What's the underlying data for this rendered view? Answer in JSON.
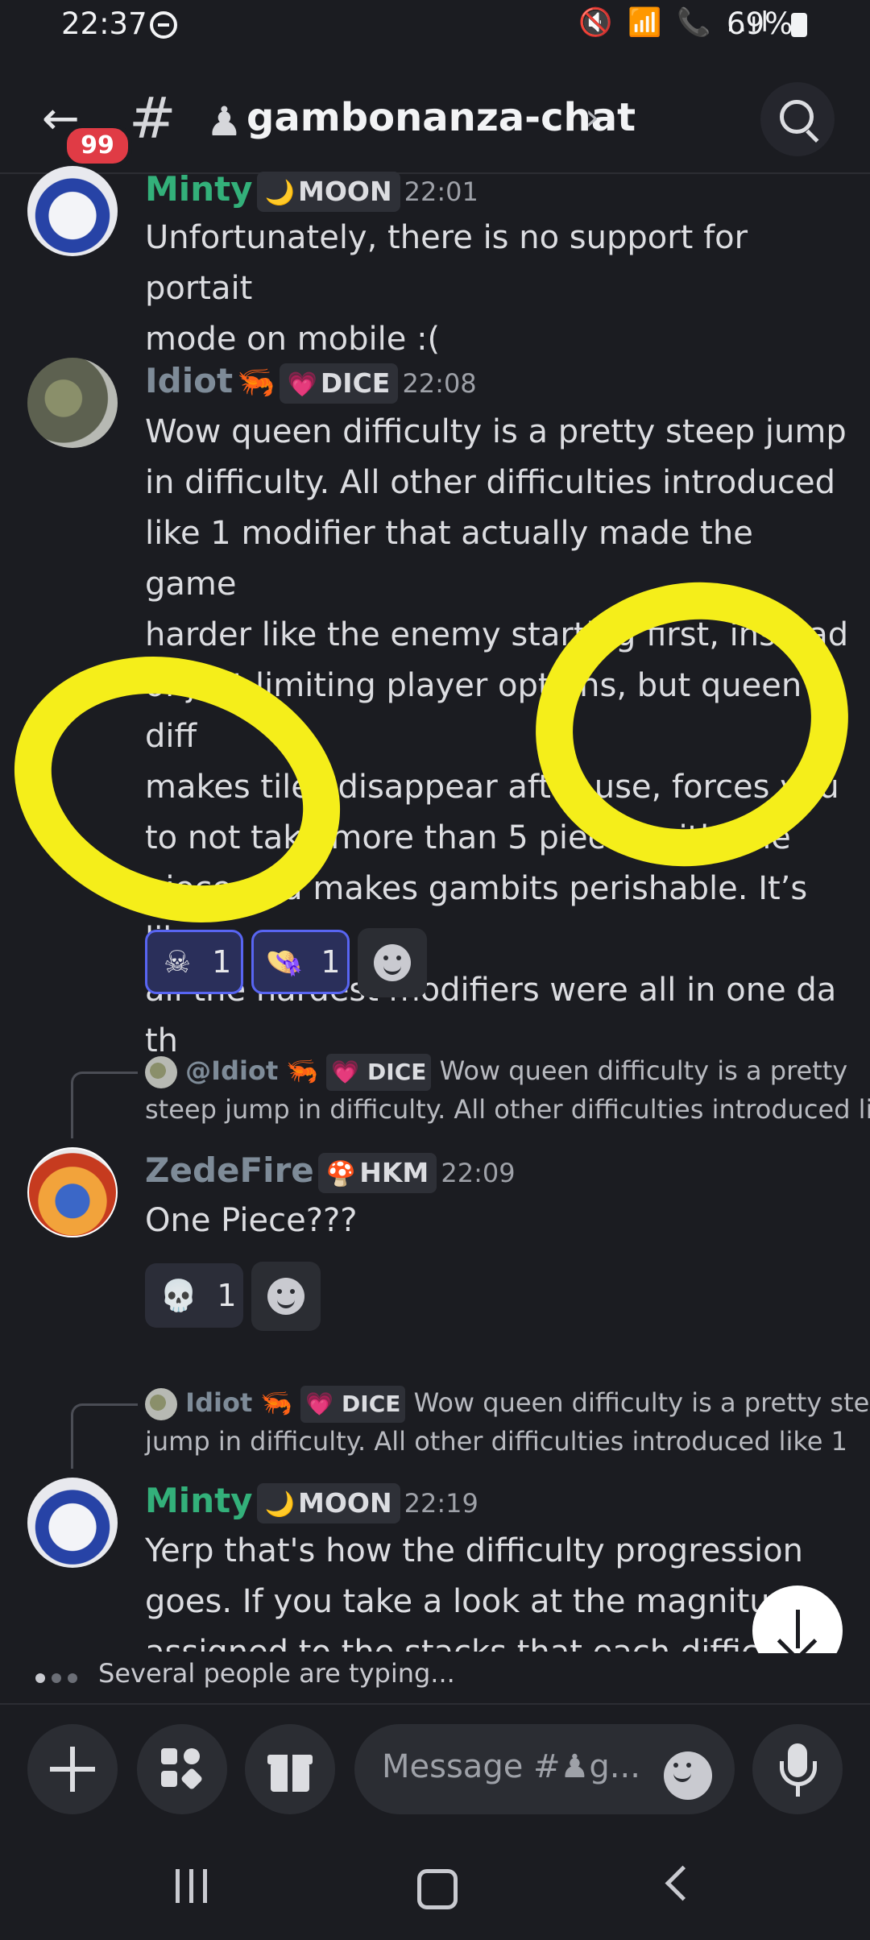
{
  "status_bar": {
    "time": "22:37",
    "signal_icons": "🔇 📶 📞 ..ıl",
    "battery": "69%"
  },
  "header": {
    "unread_count": "99",
    "hash": "#",
    "channel_emoji": "♟",
    "channel_name": "gambonanza-chat",
    "chevron": "›"
  },
  "messages": [
    {
      "user": "Minty",
      "role_icon": "🌙",
      "role": "MOON",
      "time": "22:01",
      "lines": [
        "Unfortunately, there is no support for portait",
        "mode on mobile :("
      ]
    },
    {
      "user": "Idiot",
      "user_emoji": "🦐",
      "role_icon": "💗",
      "role": "DICE",
      "time": "22:08",
      "lines": [
        "Wow queen difficulty is a pretty steep jump",
        "in difficulty. All other difficulties introduced",
        "like 1 modifier that actually made the game",
        "harder like the enemy starting first, instead",
        "of just limiting player options, but queen diff",
        "makes tiles disappear after use, forces you",
        "to not take more than 5 pieces with one",
        "piece and makes gambits perishable. It’s like",
        "all the hardest modifiers were all in one da",
        "th"
      ],
      "reactions": [
        {
          "emoji": "☠",
          "count": "1"
        },
        {
          "emoji": "👒",
          "count": "1"
        }
      ]
    },
    {
      "reply": {
        "user": "@Idiot",
        "user_emoji": "🦐",
        "role_icon": "💗",
        "role": "DICE",
        "text1": "Wow queen difficulty is a pretty",
        "text2": "steep jump in difficulty. All other difficulties introduced like"
      },
      "user": "ZedeFire",
      "role_icon": "🍄",
      "role": "HKM",
      "time": "22:09",
      "lines": [
        "One Piece???"
      ],
      "reactions": [
        {
          "emoji": "💀",
          "count": "1"
        }
      ]
    },
    {
      "reply": {
        "user": "Idiot",
        "user_emoji": "🦐",
        "role_icon": "💗",
        "role": "DICE",
        "text1": "Wow queen difficulty is a pretty steep",
        "text2": "jump in difficulty. All other difficulties introduced like 1"
      },
      "user": "Minty",
      "role_icon": "🌙",
      "role": "MOON",
      "time": "22:19",
      "lines": [
        "Yerp that's how the difficulty progression",
        "goes. If you take a look at the magnitude",
        "assigned to the stacks that each diffic"
      ]
    }
  ],
  "typing": {
    "text": "Several people are typing..."
  },
  "composer": {
    "placeholder": "Message #♟g..."
  },
  "colors": {
    "background": "#1b1c21",
    "accent": "#5865f2",
    "moon_green": "#33b07a",
    "highlight_yellow": "#f5ee1a",
    "badge_red": "#e03b45"
  }
}
